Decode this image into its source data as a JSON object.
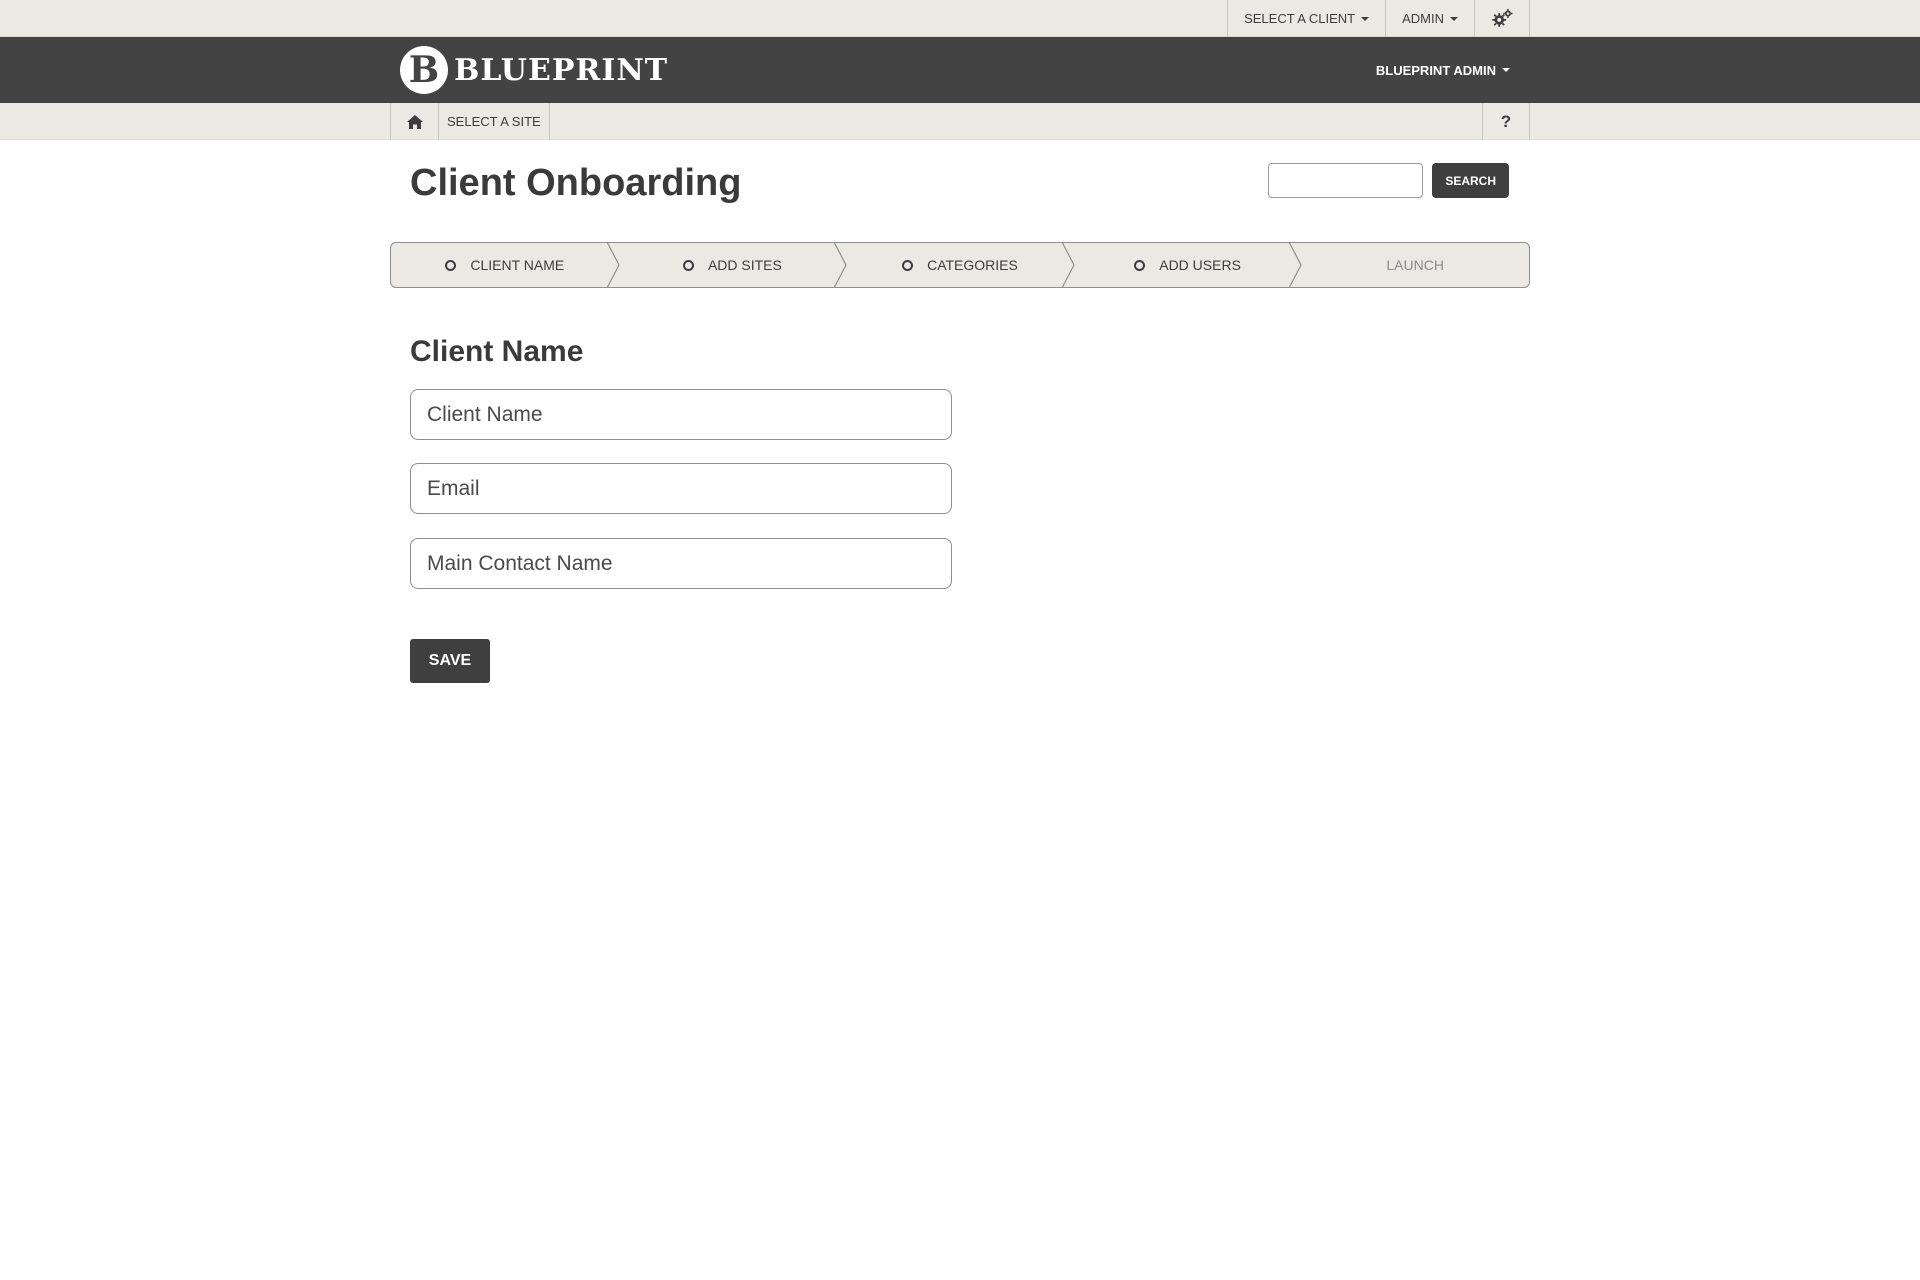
{
  "topbar": {
    "select_client": "SELECT A CLIENT",
    "admin": "ADMIN",
    "settings_icon": "gears-icon"
  },
  "brand": {
    "logo_letter": "B",
    "logo_text": "BLUEPRINT",
    "user_menu": "BLUEPRINT ADMIN"
  },
  "subnav": {
    "home_icon": "home-icon",
    "select_site": "SELECT A SITE",
    "help": "?"
  },
  "page": {
    "title": "Client Onboarding",
    "search_button": "SEARCH",
    "search_placeholder": ""
  },
  "wizard": {
    "steps": [
      {
        "label": "CLIENT NAME",
        "enabled": true
      },
      {
        "label": "ADD SITES",
        "enabled": true
      },
      {
        "label": "CATEGORIES",
        "enabled": true
      },
      {
        "label": "ADD USERS",
        "enabled": true
      },
      {
        "label": "LAUNCH",
        "enabled": false
      }
    ]
  },
  "form": {
    "section_title": "Client Name",
    "client_name_placeholder": "Client Name",
    "email_placeholder": "Email",
    "contact_placeholder": "Main Contact Name",
    "save_label": "SAVE"
  },
  "colors": {
    "header_bg": "#434343",
    "bar_bg": "#ebe9e4",
    "button_bg": "#3f3f3f"
  }
}
